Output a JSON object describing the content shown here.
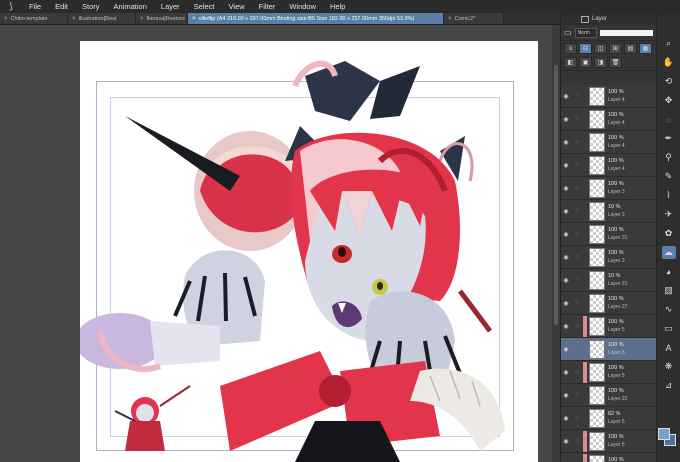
{
  "menu": {
    "items": [
      "File",
      "Edit",
      "Story",
      "Animation",
      "Layer",
      "Select",
      "View",
      "Filter",
      "Window",
      "Help"
    ]
  },
  "tabs": [
    {
      "label": "Chibo template"
    },
    {
      "label": "Illustration[Rest"
    },
    {
      "label": "flanava[Restore"
    },
    {
      "label": "ollieflip (A4 210.00 x 297.00mm Binding size:B5 Size 182.00 x 257.00mm 350dpi 53.9%)",
      "active": true
    },
    {
      "label": "Comic2*"
    }
  ],
  "layer_panel": {
    "title": "Layer",
    "blend_mode": "Norm"
  },
  "layers": [
    {
      "opacity": "100 %",
      "name": "Layer 4"
    },
    {
      "opacity": "100 %",
      "name": "Layer 4"
    },
    {
      "opacity": "100 %",
      "name": "Layer 4"
    },
    {
      "opacity": "100 %",
      "name": "Layer 4"
    },
    {
      "opacity": "100 %",
      "name": "Layer 3"
    },
    {
      "opacity": "10 %",
      "name": "Layer 3"
    },
    {
      "opacity": "100 %",
      "name": "Layer 31"
    },
    {
      "opacity": "100 %",
      "name": "Layer 3"
    },
    {
      "opacity": "10 %",
      "name": "Layer 21"
    },
    {
      "opacity": "100 %",
      "name": "Layer 27"
    },
    {
      "opacity": "100 %",
      "name": "Layer 5"
    },
    {
      "opacity": "100 %",
      "name": "Layer 5",
      "selected": true
    },
    {
      "opacity": "100 %",
      "name": "Layer 5"
    },
    {
      "opacity": "100 %",
      "name": "Layer 22"
    },
    {
      "opacity": "62 %",
      "name": "Layer 5"
    },
    {
      "opacity": "100 %",
      "name": "Layer 5"
    },
    {
      "opacity": "100 %",
      "name": "Layer 5"
    }
  ],
  "toolbar": {
    "tools": [
      "zoom-icon",
      "hand-icon",
      "rotate-icon",
      "move-icon",
      "lasso-icon",
      "pen-icon",
      "eyedropper-icon",
      "pencil-icon",
      "brush-icon",
      "airbrush-icon",
      "decoration-icon",
      "blend-icon",
      "fill-icon",
      "gradient-icon",
      "vector-icon",
      "frame-icon",
      "text-icon",
      "balloon-icon",
      "ruler-icon"
    ]
  },
  "colors": {
    "accent": "#5a7fa8",
    "main_color": "#7a9fd2",
    "sub_color": "#4e6e9c"
  }
}
